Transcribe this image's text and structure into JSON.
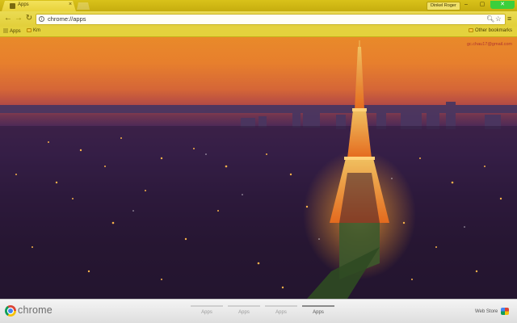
{
  "window": {
    "tab_title": "Apps",
    "tab_close": "×",
    "user_badge": "Dinkel Roger",
    "minimize": "–",
    "maximize": "▢",
    "close": "✕"
  },
  "toolbar": {
    "back": "←",
    "forward": "→",
    "reload": "↻",
    "url": "chrome://apps",
    "menu": "≡"
  },
  "bookmarks": {
    "apps_label": "Apps",
    "folder_label": "Km",
    "other_label": "Other bookmarks"
  },
  "content": {
    "account_email": "gc.chau17@gmail.com"
  },
  "bottom": {
    "brand": "chrome",
    "pages": [
      "Apps",
      "Apps",
      "Apps",
      "Apps"
    ],
    "active_page_index": 3,
    "webstore_label": "Web Store"
  },
  "colors": {
    "theme_yellow": "#e4d23d",
    "sky_orange": "#e98a2a",
    "city_purple": "#3e2452",
    "tower_glow": "#f3a43a",
    "close_button": "#3ccf3c"
  }
}
